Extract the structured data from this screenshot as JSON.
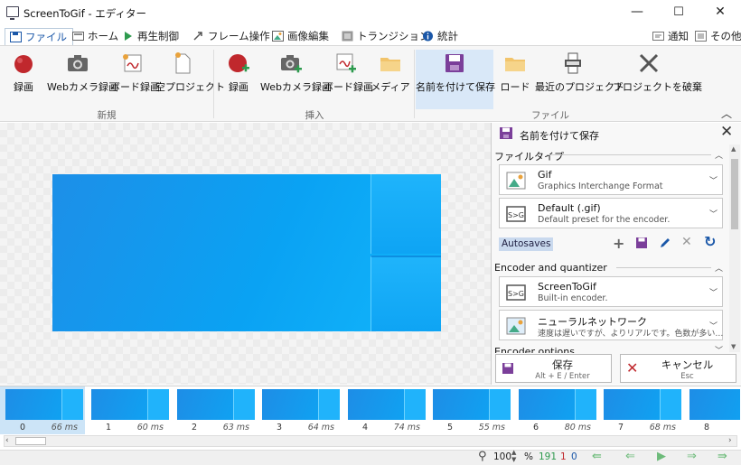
{
  "window": {
    "title": "ScreenToGif - エディター",
    "min": "—",
    "max": "☐",
    "close": "✕"
  },
  "tabs": [
    {
      "label": "ファイル",
      "color": "#1a57a8"
    },
    {
      "label": "ホーム",
      "color": "#555555"
    },
    {
      "label": "再生制御",
      "color": "#2e9a4e"
    },
    {
      "label": "フレーム操作",
      "color": "#555555"
    },
    {
      "label": "画像編集",
      "color": "#555555"
    },
    {
      "label": "トランジション",
      "color": "#555555"
    },
    {
      "label": "統計",
      "color": "#1a57a8"
    }
  ],
  "tab_right": {
    "notify": "通知",
    "other": "その他"
  },
  "ribbon": {
    "groups": {
      "new": "新規",
      "insert": "挿入",
      "file": "ファイル"
    },
    "new": {
      "record": "録画",
      "webcam": "Webカメラ録画",
      "board": "ボード録画",
      "blank": "空プロジェクト"
    },
    "insert": {
      "record": "録画",
      "webcam": "Webカメラ録画",
      "board": "ボード録画",
      "media": "メディア"
    },
    "file": {
      "save_as": "名前を付けて保存",
      "load": "ロード",
      "recent": "最近のプロジェクト",
      "discard": "プロジェクトを破棄"
    }
  },
  "panel": {
    "title": "名前を付けて保存",
    "file_type_header": "ファイルタイプ",
    "type": {
      "name": "Gif",
      "desc": "Graphics Interchange Format"
    },
    "preset": {
      "name": "Default (.gif)",
      "desc": "Default preset for the encoder."
    },
    "autosaves": "Autosaves",
    "encoder_header": "Encoder and quantizer",
    "encoder": {
      "name": "ScreenToGif",
      "desc": "Built-in encoder."
    },
    "quantizer": {
      "name": "ニューラルネットワーク",
      "desc": "速度は遅いですが、よりリアルです。色数が多い…"
    },
    "options_header": "Encoder options",
    "save": {
      "label": "保存",
      "shortcut": "Alt + E / Enter"
    },
    "cancel": {
      "label": "キャンセル",
      "shortcut": "Esc"
    }
  },
  "frames": [
    {
      "num": "0",
      "ms": "66 ms"
    },
    {
      "num": "1",
      "ms": "60 ms"
    },
    {
      "num": "2",
      "ms": "63 ms"
    },
    {
      "num": "3",
      "ms": "64 ms"
    },
    {
      "num": "4",
      "ms": "74 ms"
    },
    {
      "num": "5",
      "ms": "55 ms"
    },
    {
      "num": "6",
      "ms": "80 ms"
    },
    {
      "num": "7",
      "ms": "68 ms"
    },
    {
      "num": "8",
      "ms": ""
    }
  ],
  "status": {
    "zoom": "100",
    "zoom_unit": "%",
    "frame_count": "191",
    "selected": "1",
    "zero": "0"
  },
  "colors": {
    "accent": "#1a57a8",
    "save_purple": "#7b3f9a",
    "record_red": "#c0282d",
    "selection": "#d9e8f8",
    "nav_green": "#6dbb7a"
  }
}
